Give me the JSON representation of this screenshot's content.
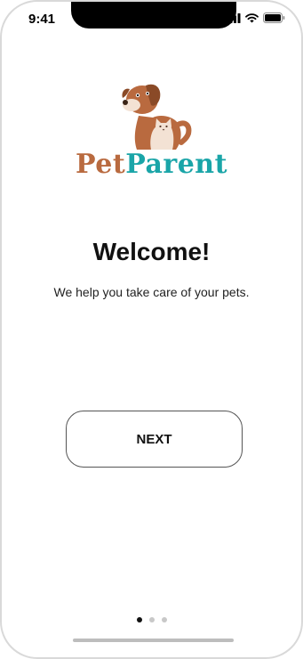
{
  "status_bar": {
    "time": "9:41",
    "icons": [
      "cellular-signal-icon",
      "wifi-icon",
      "battery-icon"
    ]
  },
  "logo": {
    "icon": "dog-and-cat-logo",
    "brand_part1": "Pet",
    "brand_part2": "Parent",
    "colors": {
      "pet": "#b96a3f",
      "parent": "#1aa5a8"
    }
  },
  "main": {
    "title": "Welcome!",
    "subtitle": "We help you take care of your pets."
  },
  "button": {
    "label": "NEXT"
  },
  "pager": {
    "total": 3,
    "active_index": 0
  }
}
